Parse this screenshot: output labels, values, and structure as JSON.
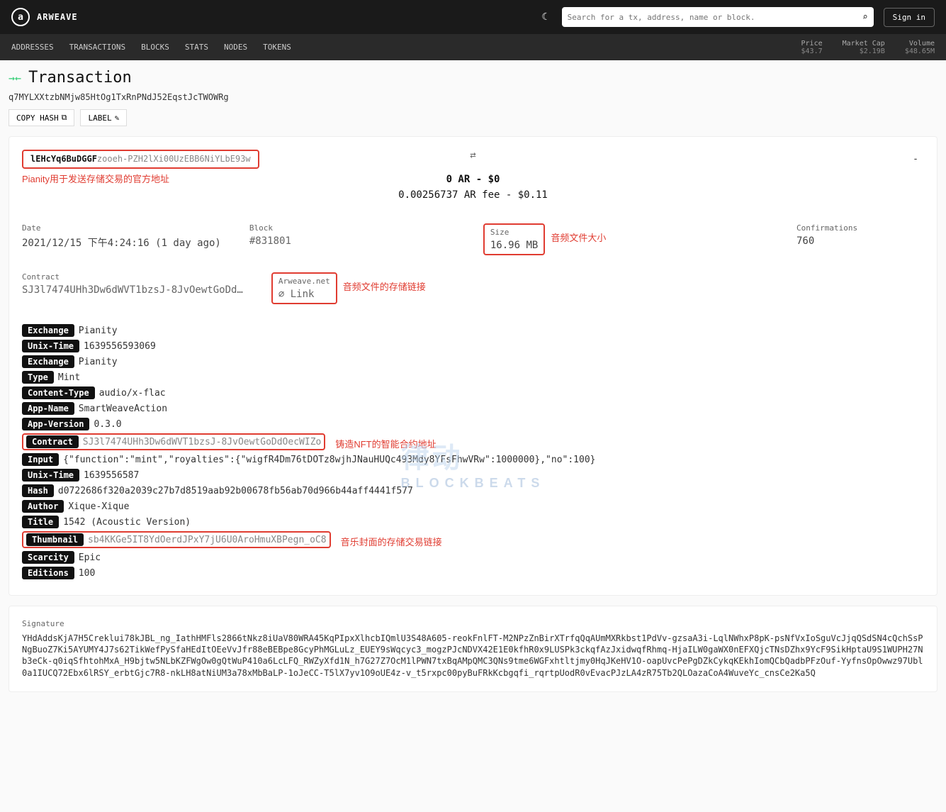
{
  "header": {
    "logo_text": "ARWEAVE",
    "logo_letter": "a",
    "search_placeholder": "Search for a tx, address, name or block.",
    "signin": "Sign in"
  },
  "nav": {
    "items": [
      "ADDRESSES",
      "TRANSACTIONS",
      "BLOCKS",
      "STATS",
      "NODES",
      "TOKENS"
    ],
    "stats": [
      {
        "label": "Price",
        "value": "$43.7"
      },
      {
        "label": "Market Cap",
        "value": "$2.19B"
      },
      {
        "label": "Volume",
        "value": "$48.65M"
      }
    ]
  },
  "page": {
    "title": "Transaction",
    "hash": "q7MYLXXtzbNMjw85HtOg1TxRnPNdJ52EqstJcTWOWRg",
    "copy_btn": "COPY HASH",
    "label_btn": "LABEL"
  },
  "tx": {
    "from_bold1": "lEHcYq6BuDGGF",
    "from_light": "zooeh-PZH2lXi00UzEBB6NiYLbE93w",
    "from_ann": "Pianity用于发送存储交易的官方地址",
    "amount": "0 AR - $0",
    "fee": "0.00256737 AR fee - $0.11",
    "to": "-"
  },
  "meta": {
    "date_label": "Date",
    "date_value": "2021/12/15 下午4:24:16 (1 day ago)",
    "block_label": "Block",
    "block_value": "#831801",
    "size_label": "Size",
    "size_value": "16.96 MB",
    "size_ann": "音频文件大小",
    "conf_label": "Confirmations",
    "conf_value": "760",
    "contract_label": "Contract",
    "contract_value": "SJ3l7474UHh3Dw6dWVT1bzsJ-8JvOewtGoDd…",
    "arweave_label": "Arweave.net",
    "arweave_value": "⌀ Link",
    "arweave_ann": "音频文件的存储链接"
  },
  "tags": [
    {
      "k": "Exchange",
      "v": "Pianity"
    },
    {
      "k": "Unix-Time",
      "v": "1639556593069"
    },
    {
      "k": "Exchange",
      "v": "Pianity"
    },
    {
      "k": "Type",
      "v": "Mint"
    },
    {
      "k": "Content-Type",
      "v": "audio/x-flac"
    },
    {
      "k": "App-Name",
      "v": "SmartWeaveAction"
    },
    {
      "k": "App-Version",
      "v": "0.3.0"
    },
    {
      "k": "Contract",
      "v": "SJ3l7474UHh3Dw6dWVT1bzsJ-8JvOewtGoDdOecWIZo",
      "boxed": true,
      "link": true,
      "ann": "铸造NFT的智能合约地址"
    },
    {
      "k": "Input",
      "v": "{\"function\":\"mint\",\"royalties\":{\"wigfR4Dm76tDOTz8wjhJNauHUQc493Mdy8YFsFhwVRw\":1000000},\"no\":100}"
    },
    {
      "k": "Unix-Time",
      "v": "1639556587"
    },
    {
      "k": "Hash",
      "v": "d0722686f320a2039c27b7d8519aab92b00678fb56ab70d966b44aff4441f577"
    },
    {
      "k": "Author",
      "v": "Xique-Xique"
    },
    {
      "k": "Title",
      "v": "1542 (Acoustic Version)"
    },
    {
      "k": "Thumbnail",
      "v": "sb4KKGe5IT8YdOerdJPxY7jU6U0AroHmuXBPegn_oC8",
      "boxed": true,
      "link": true,
      "ann": "音乐封面的存储交易链接"
    },
    {
      "k": "Scarcity",
      "v": "Epic"
    },
    {
      "k": "Editions",
      "v": "100"
    }
  ],
  "sig": {
    "label": "Signature",
    "value": "YHdAddsKjA7H5Creklui78kJBL_ng_IathHMFls2866tNkz8iUaV80WRA45KqPIpxXlhcbIQmlU3S48A605-reokFnlFT-M2NPzZnBirXTrfqQqAUmMXRkbst1PdVv-gzsaA3i-LqlNWhxP8pK-psNfVxIoSguVcJjqQSdSN4cQchSsPNgBuoZ7Ki5AYUMY4J7s62TikWefPySfaHEdItOEeVvJfr88eBEBpe8GcyPhMGLuLz_EUEY9sWqcyc3_mogzPJcNDVX42E1E0kfhR0x9LUSPk3ckqfAzJxidwqfRhmq-HjaILW0gaWX0nEFXQjcTNsDZhx9YcF9SikHptaU9S1WUPH27Nb3eCk-q0iqSfhtohMxA_H9bjtw5NLbKZFWgOw0gQtWuP410a6LcLFQ_RWZyXfd1N_h7G27Z7OcM1lPWN7txBqAMpQMC3QNs9tme6WGFxhtltjmy0HqJKeHV1O-oapUvcPePgDZkCykqKEkhIomQCbQadbPFzOuf-YyfnsOpOwwz97Ubl0a1IUCQ72Ebx6lRSY_erbtGjc7R8-nkLH8atNiUM3a78xMbBaLP-1oJeCC-T5lX7yv1O9oUE4z-v_t5rxpc00pyBuFRkKcbgqfi_rqrtpUodR0vEvacPJzLA4zR75Tb2QLOazaCoA4WuveYc_cnsCe2Ka5Q"
  },
  "watermark": {
    "main": "律动",
    "sub": "BLOCKBEATS"
  }
}
